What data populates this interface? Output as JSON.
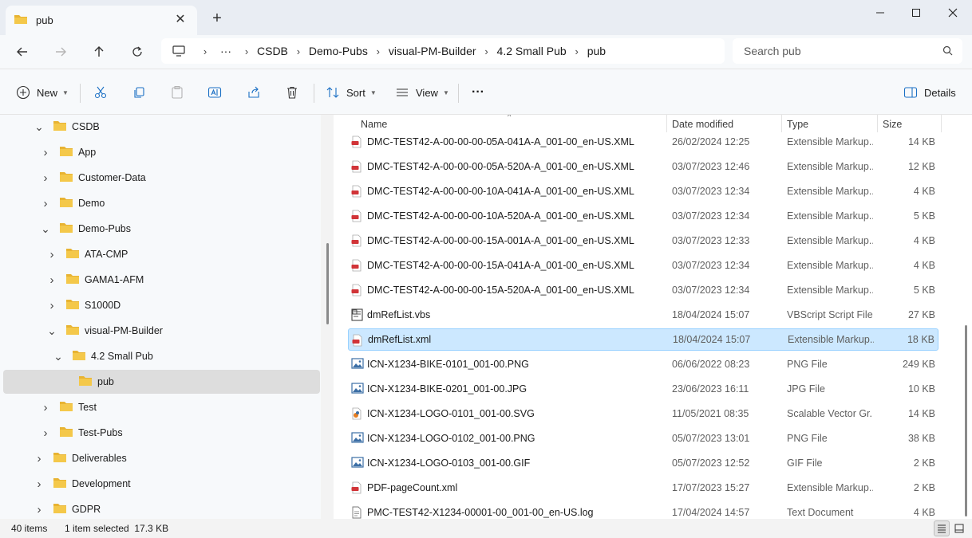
{
  "window": {
    "tab_title": "pub",
    "new_tab": "+",
    "close_tab": "✕"
  },
  "address": {
    "ellipsis": "···",
    "breadcrumbs": [
      "CSDB",
      "Demo-Pubs",
      "visual-PM-Builder",
      "4.2 Small Pub",
      "pub"
    ],
    "separator": "›"
  },
  "search": {
    "placeholder": "Search pub"
  },
  "toolbar": {
    "new_label": "New",
    "sort_label": "Sort",
    "view_label": "View",
    "more_label": "···",
    "details_label": "Details"
  },
  "sidebar": {
    "items": [
      {
        "label": "CSDB",
        "level": 0,
        "expanded": true
      },
      {
        "label": "App",
        "level": 1,
        "expanded": false
      },
      {
        "label": "Customer-Data",
        "level": 1,
        "expanded": false
      },
      {
        "label": "Demo",
        "level": 1,
        "expanded": false
      },
      {
        "label": "Demo-Pubs",
        "level": 1,
        "expanded": true
      },
      {
        "label": "ATA-CMP",
        "level": 2,
        "expanded": false
      },
      {
        "label": "GAMA1-AFM",
        "level": 2,
        "expanded": false
      },
      {
        "label": "S1000D",
        "level": 2,
        "expanded": false
      },
      {
        "label": "visual-PM-Builder",
        "level": 2,
        "expanded": true
      },
      {
        "label": "4.2 Small Pub",
        "level": 3,
        "expanded": true
      },
      {
        "label": "pub",
        "level": 4,
        "expanded": null,
        "selected": true
      },
      {
        "label": "Test",
        "level": 1,
        "expanded": false
      },
      {
        "label": "Test-Pubs",
        "level": 1,
        "expanded": false
      },
      {
        "label": "Deliverables",
        "level": 0,
        "expanded": false
      },
      {
        "label": "Development",
        "level": 0,
        "expanded": false
      },
      {
        "label": "GDPR",
        "level": 0,
        "expanded": false
      }
    ]
  },
  "columns": {
    "name": "Name",
    "date": "Date modified",
    "type": "Type",
    "size": "Size"
  },
  "files": [
    {
      "name": "DMC-TEST42-A-00-00-00-05A-041A-A_001-00_en-US.XML",
      "date": "26/02/2024 12:25",
      "type": "Extensible Markup...",
      "size": "14 KB",
      "icon": "xml-file-icon"
    },
    {
      "name": "DMC-TEST42-A-00-00-00-05A-520A-A_001-00_en-US.XML",
      "date": "03/07/2023 12:46",
      "type": "Extensible Markup...",
      "size": "12 KB",
      "icon": "xml-file-icon"
    },
    {
      "name": "DMC-TEST42-A-00-00-00-10A-041A-A_001-00_en-US.XML",
      "date": "03/07/2023 12:34",
      "type": "Extensible Markup...",
      "size": "4 KB",
      "icon": "xml-file-icon"
    },
    {
      "name": "DMC-TEST42-A-00-00-00-10A-520A-A_001-00_en-US.XML",
      "date": "03/07/2023 12:34",
      "type": "Extensible Markup...",
      "size": "5 KB",
      "icon": "xml-file-icon"
    },
    {
      "name": "DMC-TEST42-A-00-00-00-15A-001A-A_001-00_en-US.XML",
      "date": "03/07/2023 12:33",
      "type": "Extensible Markup...",
      "size": "4 KB",
      "icon": "xml-file-icon"
    },
    {
      "name": "DMC-TEST42-A-00-00-00-15A-041A-A_001-00_en-US.XML",
      "date": "03/07/2023 12:34",
      "type": "Extensible Markup...",
      "size": "4 KB",
      "icon": "xml-file-icon"
    },
    {
      "name": "DMC-TEST42-A-00-00-00-15A-520A-A_001-00_en-US.XML",
      "date": "03/07/2023 12:34",
      "type": "Extensible Markup...",
      "size": "5 KB",
      "icon": "xml-file-icon"
    },
    {
      "name": "dmRefList.vbs",
      "date": "18/04/2024 15:07",
      "type": "VBScript Script File",
      "size": "27 KB",
      "icon": "script-file-icon"
    },
    {
      "name": "dmRefList.xml",
      "date": "18/04/2024 15:07",
      "type": "Extensible Markup...",
      "size": "18 KB",
      "icon": "xml-file-icon",
      "selected": true
    },
    {
      "name": "ICN-X1234-BIKE-0101_001-00.PNG",
      "date": "06/06/2022 08:23",
      "type": "PNG File",
      "size": "249 KB",
      "icon": "image-file-icon"
    },
    {
      "name": "ICN-X1234-BIKE-0201_001-00.JPG",
      "date": "23/06/2023 16:11",
      "type": "JPG File",
      "size": "10 KB",
      "icon": "image-file-icon"
    },
    {
      "name": "ICN-X1234-LOGO-0101_001-00.SVG",
      "date": "11/05/2021 08:35",
      "type": "Scalable Vector Gr...",
      "size": "14 KB",
      "icon": "svg-file-icon"
    },
    {
      "name": "ICN-X1234-LOGO-0102_001-00.PNG",
      "date": "05/07/2023 13:01",
      "type": "PNG File",
      "size": "38 KB",
      "icon": "image-file-icon"
    },
    {
      "name": "ICN-X1234-LOGO-0103_001-00.GIF",
      "date": "05/07/2023 12:52",
      "type": "GIF File",
      "size": "2 KB",
      "icon": "image-file-icon"
    },
    {
      "name": "PDF-pageCount.xml",
      "date": "17/07/2023 15:27",
      "type": "Extensible Markup...",
      "size": "2 KB",
      "icon": "xml-file-icon"
    },
    {
      "name": "PMC-TEST42-X1234-00001-00_001-00_en-US.log",
      "date": "17/04/2024 14:57",
      "type": "Text Document",
      "size": "4 KB",
      "icon": "text-file-icon"
    }
  ],
  "status": {
    "item_count": "40 items",
    "selection": "1 item selected  17.3 KB"
  },
  "colors": {
    "folder": "#f4c84a",
    "folder_dark": "#e8b332",
    "selection": "#cce8ff",
    "accent": "#0067c0",
    "xml_red": "#d13438"
  }
}
